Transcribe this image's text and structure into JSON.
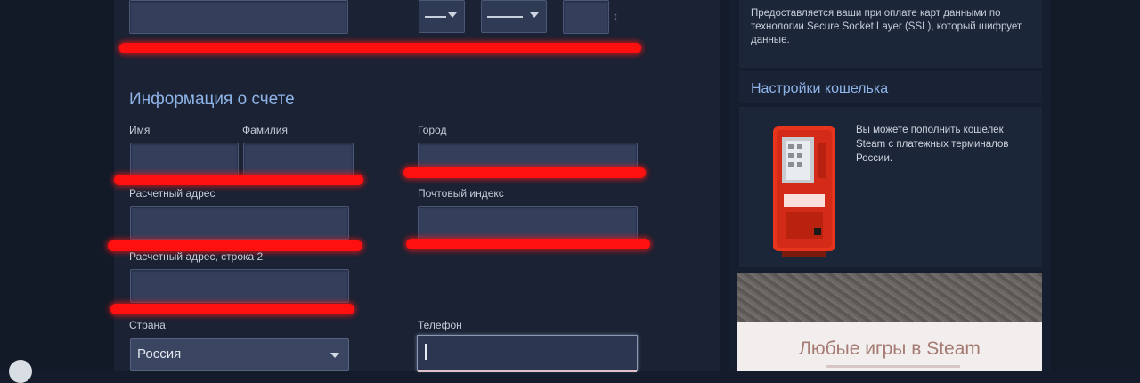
{
  "form": {
    "section_title": "Информация о счете",
    "labels": {
      "first_name": "Имя",
      "last_name": "Фамилия",
      "city": "Город",
      "billing_address": "Расчетный адрес",
      "postal_code": "Почтовый индекс",
      "billing_address_2": "Расчетный адрес, строка 2",
      "country": "Страна",
      "phone": "Телефон"
    },
    "country_value": "Россия"
  },
  "sidebar": {
    "info_text": "Предоставляется ваши при оплате карт данными по технологии Secure Socket Layer (SSL), который шифрует данные.",
    "wallet_title": "Настройки кошелька",
    "wallet_text": "Вы можете пополнить кошелек Steam с платежных терминалов России.",
    "promo_text": "Любые игры в Steam"
  },
  "colors": {
    "accent_blue": "#8fb4e8",
    "redaction_red": "#ff1010",
    "kiosk_red": "#e8341c"
  }
}
